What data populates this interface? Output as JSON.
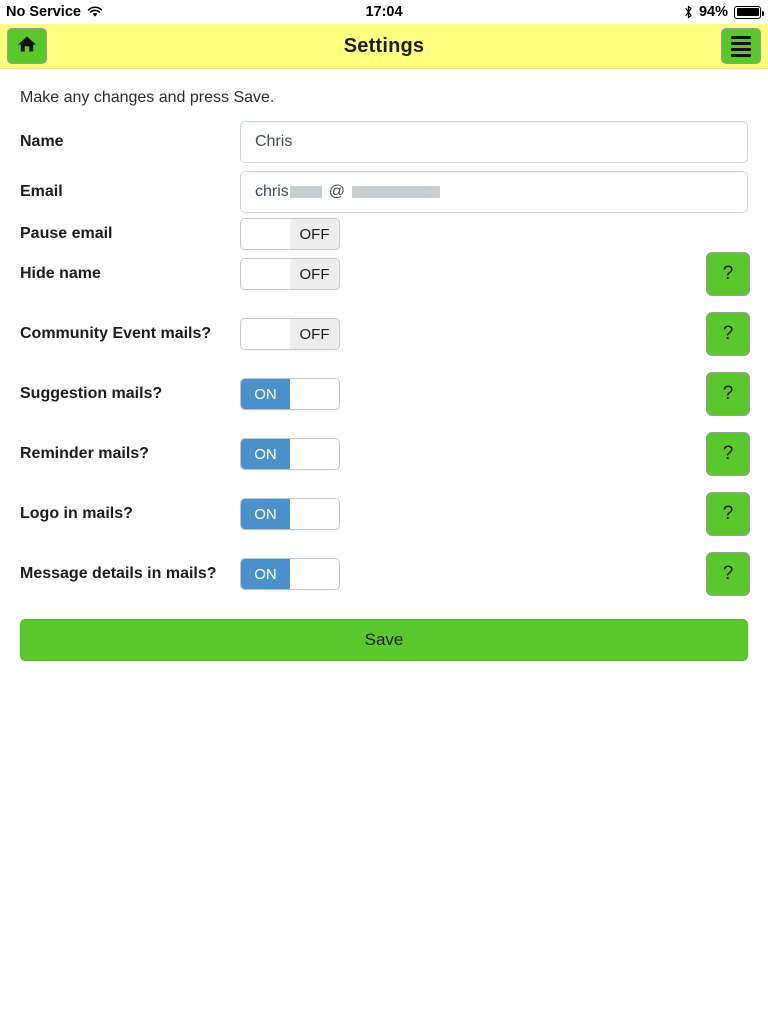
{
  "status_bar": {
    "carrier": "No Service",
    "wifi_icon": "wifi-icon",
    "time": "17:04",
    "bluetooth_icon": "bluetooth-icon",
    "battery_percent": "94%",
    "battery_icon": "battery-icon"
  },
  "nav": {
    "title": "Settings",
    "home_icon": "home-icon",
    "menu_icon": "hamburger-menu-icon",
    "background_color": "#ffff80",
    "button_color": "#5ac72c"
  },
  "intro_text": "Make any changes and press Save.",
  "fields": [
    {
      "label": "Name",
      "value": "Chris"
    },
    {
      "label": "Email",
      "value_prefix": "chris",
      "at": "@",
      "redacted": true
    }
  ],
  "toggles": [
    {
      "label": "Pause email",
      "state": "OFF",
      "on_label": "ON",
      "off_label": "OFF",
      "help": false
    },
    {
      "label": "Hide name",
      "state": "OFF",
      "on_label": "ON",
      "off_label": "OFF",
      "help": true
    },
    {
      "label": "Community Event mails?",
      "state": "OFF",
      "on_label": "ON",
      "off_label": "OFF",
      "help": true
    },
    {
      "label": "Suggestion mails?",
      "state": "ON",
      "on_label": "ON",
      "off_label": "OFF",
      "help": true
    },
    {
      "label": "Reminder mails?",
      "state": "ON",
      "on_label": "ON",
      "off_label": "OFF",
      "help": true
    },
    {
      "label": "Logo in mails?",
      "state": "ON",
      "on_label": "ON",
      "off_label": "OFF",
      "help": true
    },
    {
      "label": "Message details in mails?",
      "state": "ON",
      "on_label": "ON",
      "off_label": "OFF",
      "help": true
    }
  ],
  "help_label": "?",
  "save": {
    "label": "Save",
    "color": "#5ac72c"
  },
  "colors": {
    "toggle_on": "#4a90ca",
    "toggle_off_track": "#ededed",
    "accent_green": "#5ac72c",
    "header_yellow": "#ffff80"
  }
}
